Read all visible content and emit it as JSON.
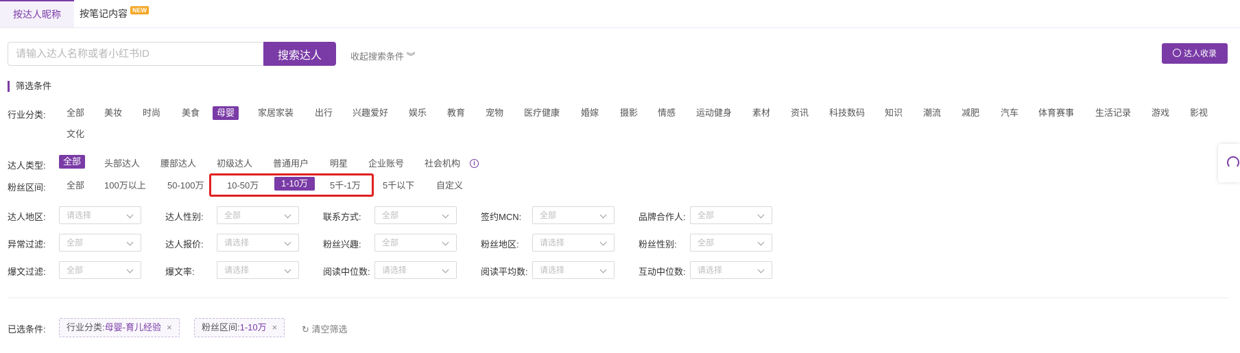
{
  "tabs": [
    {
      "label": "按达人昵称"
    },
    {
      "label": "按笔记内容",
      "badge": "NEW"
    }
  ],
  "search": {
    "placeholder": "请输入达人名称或者小红书ID",
    "button_label": "搜索达人",
    "collapse_label": "收起搜索条件 ︾"
  },
  "collect_button": {
    "label": "达人收录",
    "icon": "user-circle-icon"
  },
  "filters": {
    "title": "筛选条件",
    "industry": {
      "label": "行业分类:",
      "options": [
        "全部",
        "美妆",
        "时尚",
        "美食",
        "母婴",
        "家居家装",
        "出行",
        "兴趣爱好",
        "娱乐",
        "教育",
        "宠物",
        "医疗健康",
        "婚嫁",
        "摄影",
        "情感",
        "运动健身",
        "素材",
        "资讯",
        "科技数码",
        "知识",
        "潮流",
        "减肥",
        "汽车",
        "体育赛事",
        "生活记录",
        "游戏",
        "影视",
        "文化"
      ],
      "selected": "母婴"
    },
    "type": {
      "label": "达人类型:",
      "options": [
        "全部",
        "头部达人",
        "腰部达人",
        "初级达人",
        "普通用户",
        "明星",
        "企业账号",
        "社会机构"
      ],
      "selected": "全部"
    },
    "fans": {
      "label": "粉丝区间:",
      "options": [
        "全部",
        "100万以上",
        "50-100万",
        "10-50万",
        "1-10万",
        "5千-1万",
        "5千以下",
        "自定义"
      ],
      "selected": "1-10万"
    },
    "dropdowns": [
      {
        "label": "达人地区:",
        "value": "请选择"
      },
      {
        "label": "达人性别:",
        "value": "全部"
      },
      {
        "label": "联系方式:",
        "value": "全部"
      },
      {
        "label": "签约MCN:",
        "value": "全部"
      },
      {
        "label": "品牌合作人:",
        "value": "全部"
      },
      {
        "label": "异常过滤:",
        "value": "全部"
      },
      {
        "label": "达人报价:",
        "value": "请选择"
      },
      {
        "label": "粉丝兴趣:",
        "value": "全部"
      },
      {
        "label": "粉丝地区:",
        "value": "请选择"
      },
      {
        "label": "粉丝性别:",
        "value": "全部"
      },
      {
        "label": "爆文过滤:",
        "value": "全部"
      },
      {
        "label": "爆文率:",
        "value": "请选择"
      },
      {
        "label": "阅读中位数:",
        "value": "请选择"
      },
      {
        "label": "阅读平均数:",
        "value": "请选择"
      },
      {
        "label": "互动中位数:",
        "value": "请选择"
      }
    ]
  },
  "selected_conditions": {
    "label": "已选条件:",
    "chips": [
      {
        "key": "行业分类:",
        "value": "母婴-育儿经验",
        "close": "×"
      },
      {
        "key": "粉丝区间:",
        "value": "1-10万",
        "close": "×"
      }
    ],
    "clear_label": "清空筛选"
  },
  "colors": {
    "accent": "#7a3ba6",
    "highlight": "#e02020"
  }
}
